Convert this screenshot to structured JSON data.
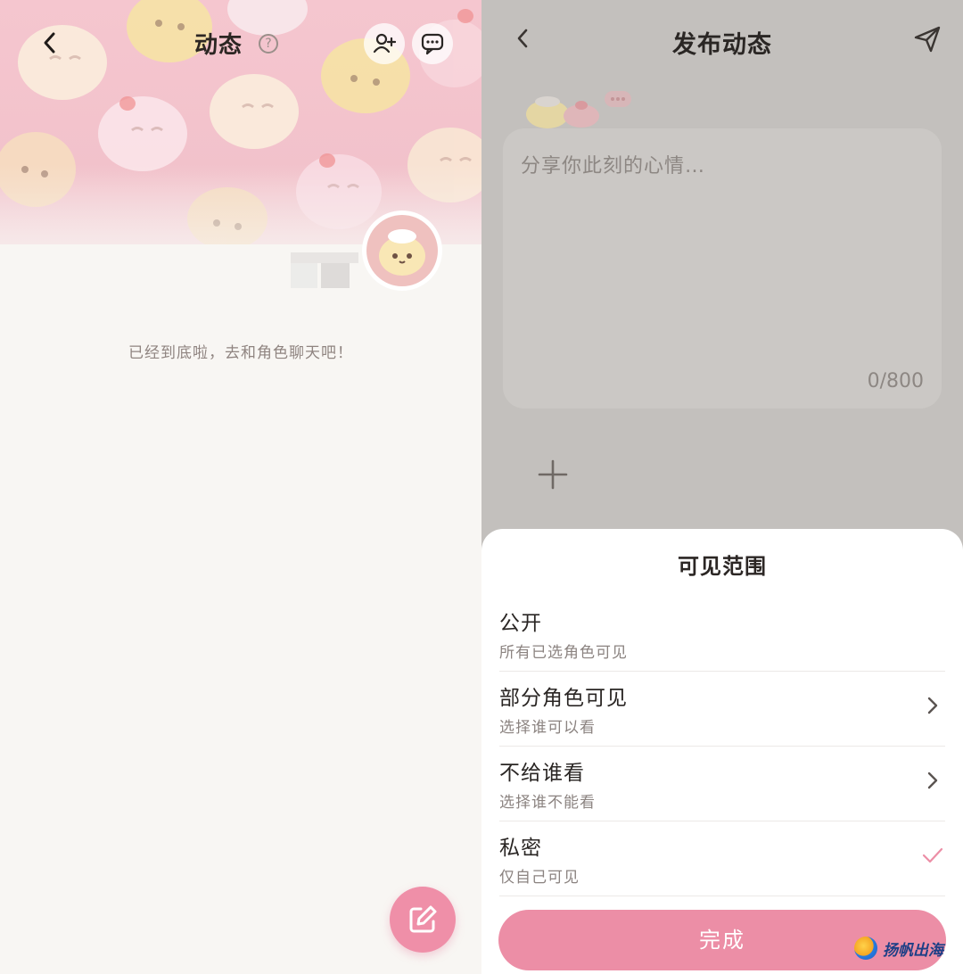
{
  "left": {
    "header": {
      "title": "动态",
      "help_glyph": "?"
    },
    "end_of_list": "已经到底啦，去和角色聊天吧！",
    "icons": {
      "back": "chevron-left-icon",
      "help": "question-circle-icon",
      "add_friend": "person-add-icon",
      "message": "chat-bubble-icon",
      "compose": "edit-pencil-icon"
    }
  },
  "right": {
    "header": {
      "title": "发布动态"
    },
    "composer": {
      "placeholder": "分享你此刻的心情…",
      "counter": "0/800",
      "add_glyph": "+"
    },
    "visibility_sheet": {
      "title": "可见范围",
      "options": [
        {
          "title": "公开",
          "subtitle": "所有已选角色可见",
          "trailing": "none"
        },
        {
          "title": "部分角色可见",
          "subtitle": "选择谁可以看",
          "trailing": "chevron"
        },
        {
          "title": "不给谁看",
          "subtitle": "选择谁不能看",
          "trailing": "chevron"
        },
        {
          "title": "私密",
          "subtitle": "仅自己可见",
          "trailing": "check",
          "selected": true
        }
      ],
      "done_label": "完成"
    },
    "watermark": "扬帆出海"
  },
  "colors": {
    "accent_pink": "#ec8ea6",
    "banner_pink": "#f5c6cf",
    "overlay_gray": "#c3c0bd",
    "text_dark": "#2a2624",
    "text_muted": "#8b8380"
  }
}
